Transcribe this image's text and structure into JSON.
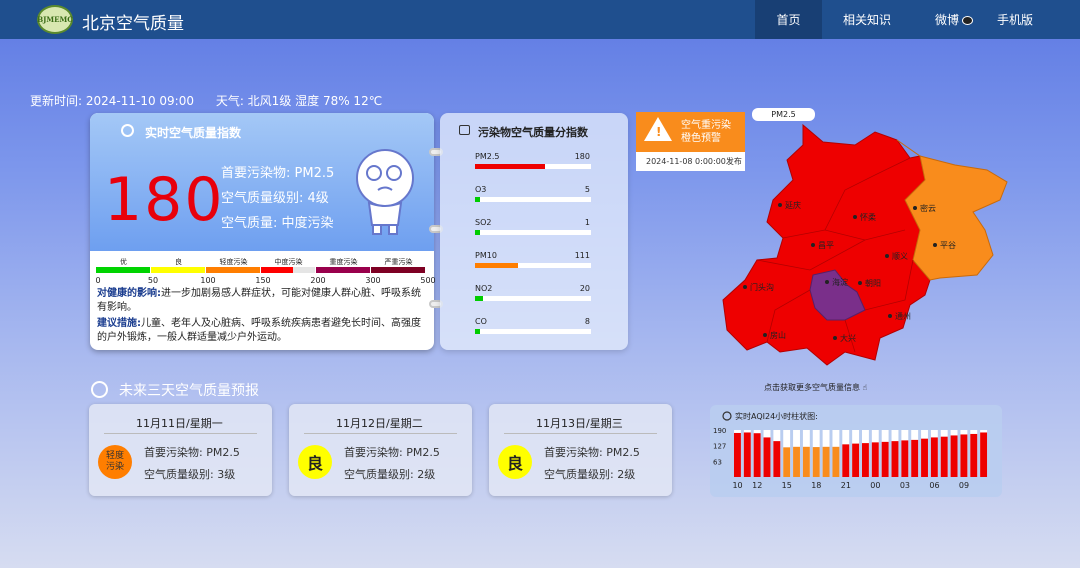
{
  "header": {
    "logo_text": "BJMEMC",
    "site_title": "北京空气质量",
    "nav": [
      {
        "label": "首页",
        "active": true
      },
      {
        "label": "相关知识",
        "active": false
      },
      {
        "label": "微博",
        "active": false
      },
      {
        "label": "手机版",
        "active": false
      }
    ]
  },
  "status": {
    "update_time": "更新时间:  2024-11-10 09:00",
    "weather": "天气:  北风1级 湿度 78% 12℃"
  },
  "aqi_card": {
    "title": "实时空气质量指数",
    "value": "180",
    "primary_pollutant": "首要污染物:  PM2.5",
    "level": "空气质量级别:  4级",
    "quality": "空气质量:  中度污染",
    "scale": [
      {
        "label": "优",
        "color": "#00d400",
        "fill": 1.0
      },
      {
        "label": "良",
        "color": "#ffff00",
        "fill": 1.0
      },
      {
        "label": "轻度污染",
        "color": "#ff7e00",
        "fill": 1.0
      },
      {
        "label": "中度污染",
        "color": "#ff0000",
        "fill": 0.6
      },
      {
        "label": "重度污染",
        "color": "#99004c",
        "fill": 1.0
      },
      {
        "label": "严重污染",
        "color": "#7e0023",
        "fill": 1.0
      }
    ],
    "ticks": [
      "0",
      "50",
      "100",
      "150",
      "200",
      "300",
      "500"
    ],
    "health_label": "对健康的影响:",
    "health_text": "进一步加剧易感人群症状，可能对健康人群心脏、呼吸系统有影响。",
    "advice_label": "建议措施:",
    "advice_text": "儿童、老年人及心脏病、呼吸系统疾病患者避免长时间、高强度的户外锻炼，一般人群适量减少户外运动。"
  },
  "pollutants": {
    "title": "污染物空气质量分指数",
    "items": [
      {
        "name": "PM2.5",
        "value": "180",
        "fill": 0.6,
        "color": "#ee0000"
      },
      {
        "name": "O3",
        "value": "5",
        "fill": 0.02,
        "color": "#00cc00"
      },
      {
        "name": "SO2",
        "value": "1",
        "fill": 0.01,
        "color": "#00cc00"
      },
      {
        "name": "PM10",
        "value": "111",
        "fill": 0.37,
        "color": "#ff7e00"
      },
      {
        "name": "NO2",
        "value": "20",
        "fill": 0.07,
        "color": "#00cc00"
      },
      {
        "name": "CO",
        "value": "8",
        "fill": 0.03,
        "color": "#00cc00"
      }
    ]
  },
  "alert": {
    "text_line1": "空气重污染",
    "text_line2": "橙色预警",
    "date": "2024-11-08 0:00:00发布"
  },
  "map": {
    "tag": "PM2.5",
    "caption": "点击获取更多空气质量信息",
    "districts": [
      "延庆",
      "怀柔",
      "密云",
      "平谷",
      "顺义",
      "昌平",
      "门头沟",
      "海淀",
      "朝阳",
      "通州",
      "房山",
      "大兴"
    ],
    "colors": {
      "heavy": "#ee0000",
      "orange": "#f98c1c",
      "purple": "#7a2f8a"
    }
  },
  "forecast": {
    "title": "未来三天空气质量预报",
    "days": [
      {
        "date": "11月11日/星期一",
        "badge": "轻度污染",
        "badge_line1": "轻度",
        "badge_line2": "污染",
        "badge_color": "#ff7e00",
        "pollutant": "首要污染物:  PM2.5",
        "level": "空气质量级别:  3级"
      },
      {
        "date": "11月12日/星期二",
        "badge": "良",
        "badge_line1": "良",
        "badge_line2": "",
        "badge_color": "#ffff00",
        "pollutant": "首要污染物:  PM2.5",
        "level": "空气质量级别:  2级"
      },
      {
        "date": "11月13日/星期三",
        "badge": "良",
        "badge_line1": "良",
        "badge_line2": "",
        "badge_color": "#ffff00",
        "pollutant": "首要污染物:  PM2.5",
        "level": "空气质量级别:  2级"
      }
    ]
  },
  "chart_data": {
    "type": "bar",
    "title": "实时AQI24小时柱状图:",
    "yticks": [
      "190",
      "127",
      "63"
    ],
    "ylim": [
      0,
      190
    ],
    "xticks": [
      "10",
      "12",
      "15",
      "18",
      "21",
      "00",
      "03",
      "06",
      "09"
    ],
    "values": [
      178,
      180,
      177,
      160,
      145,
      120,
      122,
      122,
      121,
      122,
      122,
      132,
      135,
      137,
      140,
      142,
      145,
      148,
      150,
      155,
      160,
      163,
      168,
      172,
      174,
      180
    ],
    "colors": [
      "#ee0000",
      "#ee0000",
      "#ee0000",
      "#ee0000",
      "#ee0000",
      "#f98c1c",
      "#f98c1c",
      "#f98c1c",
      "#f98c1c",
      "#f98c1c",
      "#f98c1c",
      "#ee0000",
      "#ee0000",
      "#ee0000",
      "#ee0000",
      "#ee0000",
      "#ee0000",
      "#ee0000",
      "#ee0000",
      "#ee0000",
      "#ee0000",
      "#ee0000",
      "#ee0000",
      "#ee0000",
      "#ee0000",
      "#ee0000"
    ]
  }
}
